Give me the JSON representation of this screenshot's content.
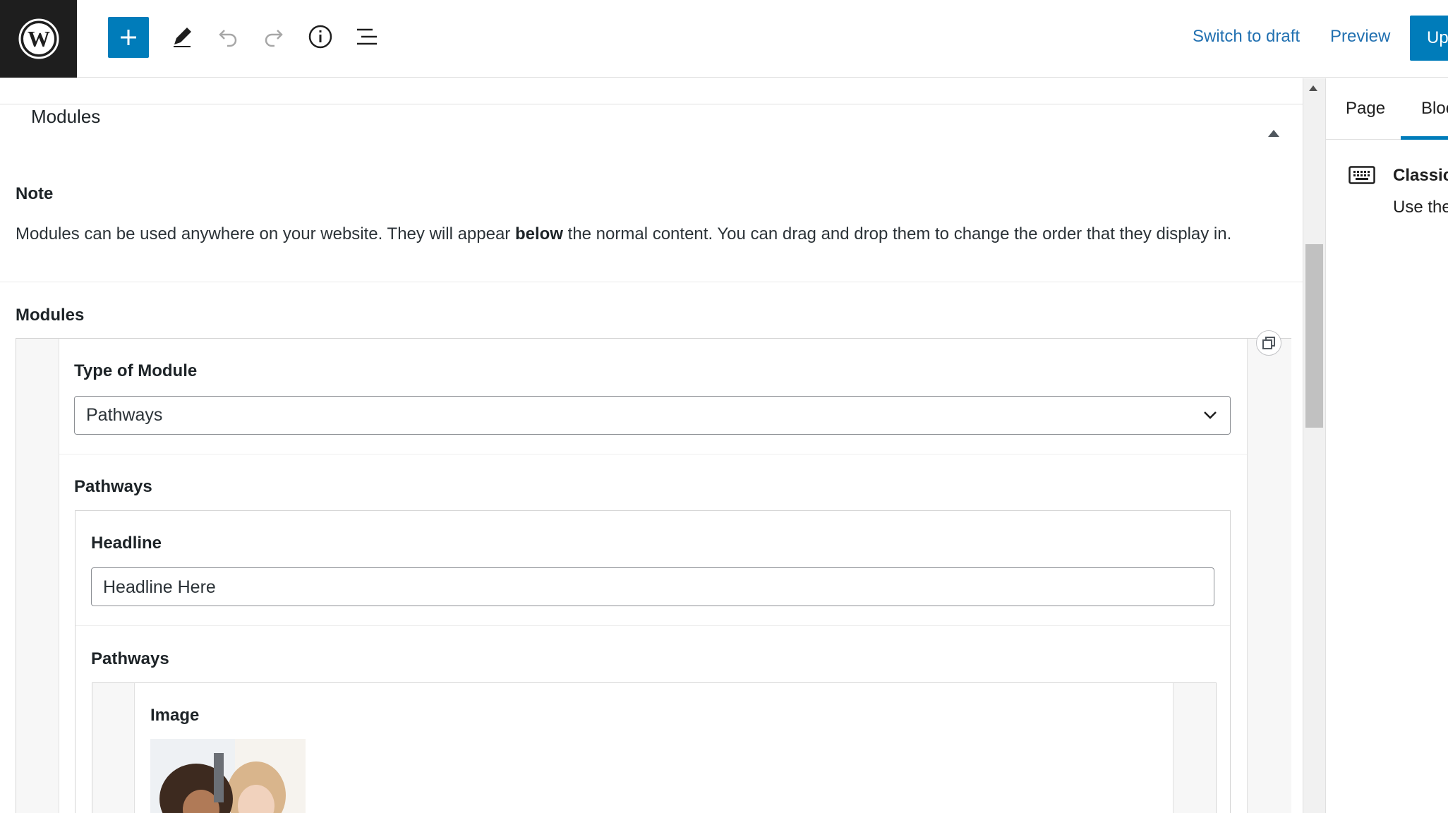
{
  "toolbar": {
    "logo_icon": "wordpress-logo-icon",
    "add_icon": "plus-icon",
    "edit_icon": "pencil-icon",
    "undo_icon": "undo-icon",
    "redo_icon": "redo-icon",
    "info_icon": "info-icon",
    "list_icon": "list-view-icon",
    "switch_to_draft": "Switch to draft",
    "preview": "Preview",
    "update": "Up",
    "accent_color": "#007cba"
  },
  "metabox": {
    "title": "Modules",
    "note_label": "Note",
    "note_text_before": "Modules can be used anywhere on your website. They will appear ",
    "note_text_bold": "below",
    "note_text_after": " the normal content. You can drag and drop them to change the order that they display in.",
    "modules_label": "Modules"
  },
  "module": {
    "type_label": "Type of Module",
    "type_value": "Pathways",
    "pathways_group_label": "Pathways",
    "headline_label": "Headline",
    "headline_value": "Headline Here",
    "pathways_label": "Pathways",
    "image_label": "Image"
  },
  "sidebar": {
    "tabs": [
      "Page",
      "Bloc"
    ],
    "active_tab": "Bloc",
    "block_icon": "keyboard-icon",
    "block_title": "Classic",
    "block_desc": "Use the"
  }
}
